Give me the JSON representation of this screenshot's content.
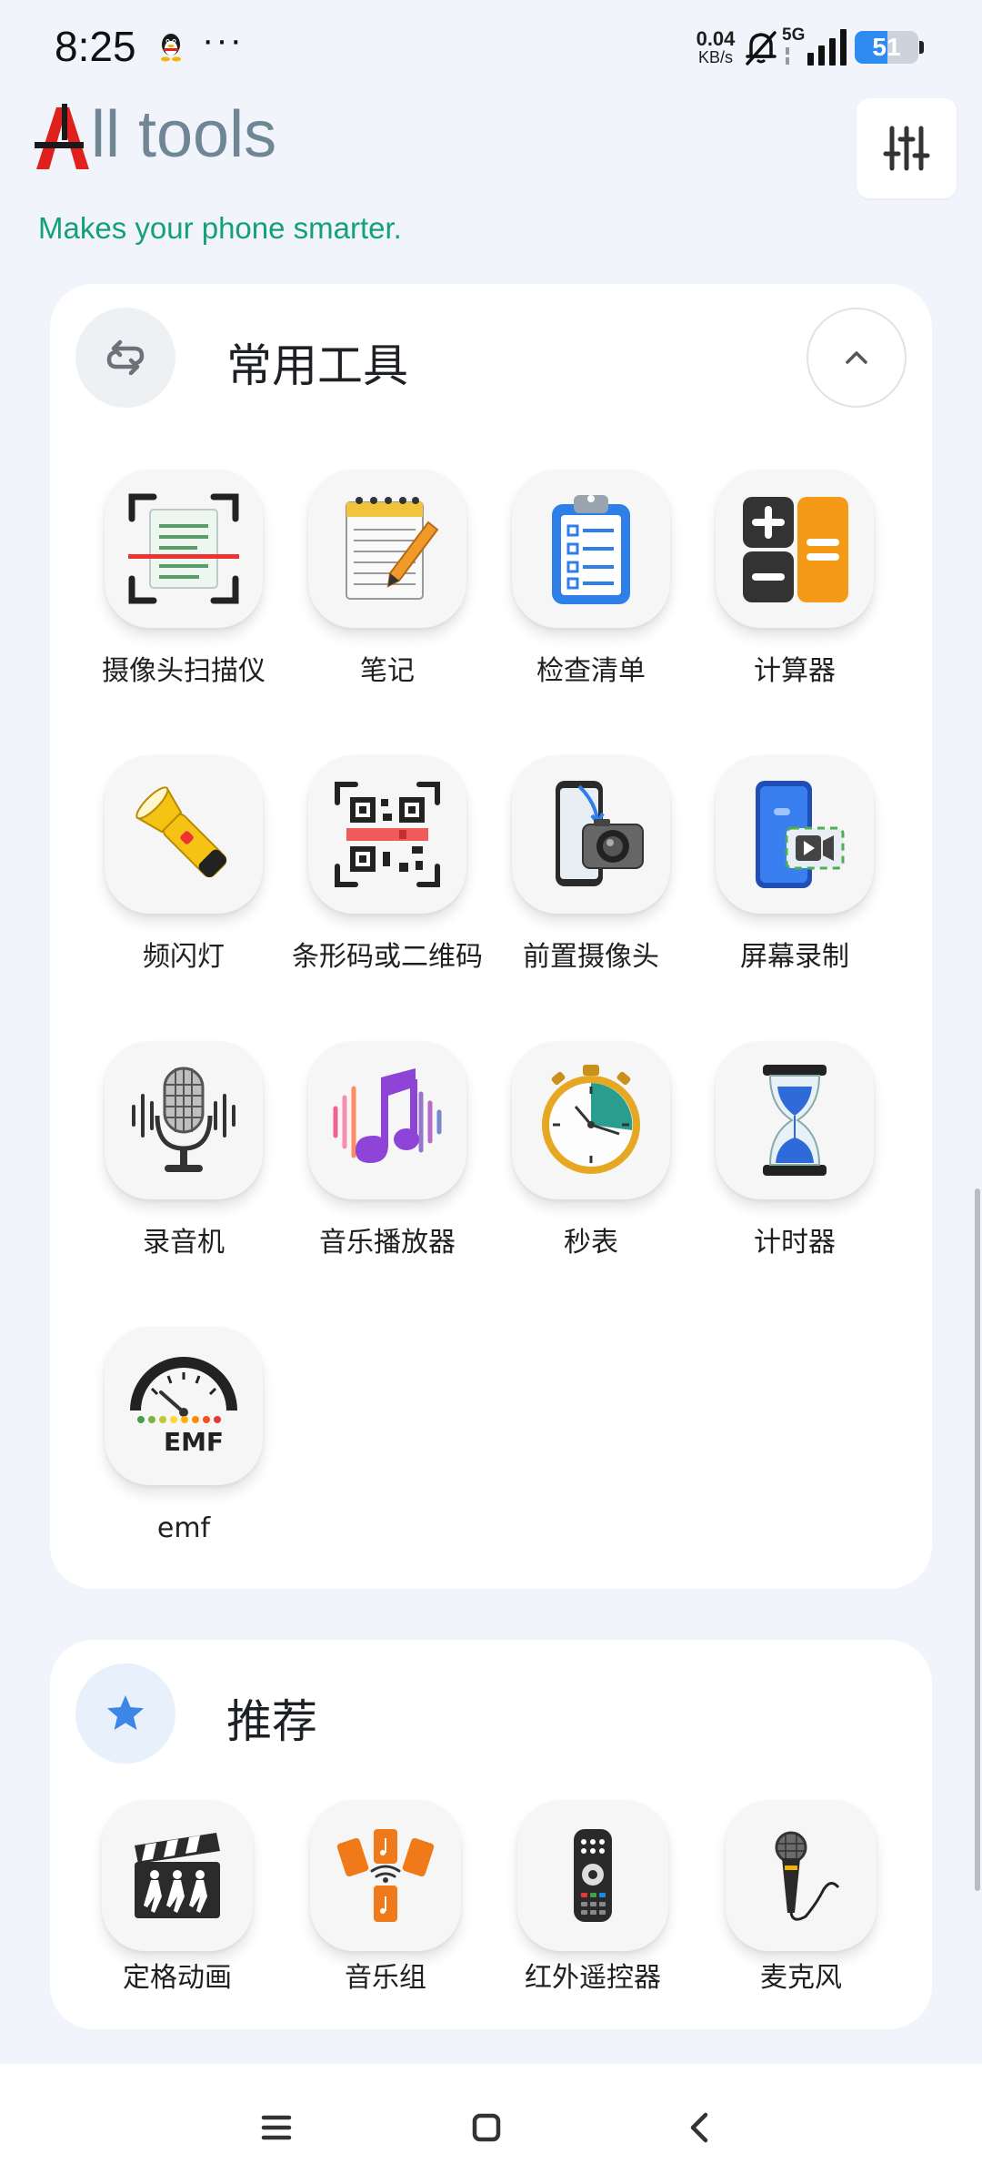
{
  "status_bar": {
    "time": "8:25",
    "dots": "···",
    "net_speed_value": "0.04",
    "net_speed_unit": "KB/s",
    "network": "5G",
    "battery": "51",
    "battery_level": 0.51
  },
  "header": {
    "title": "ll tools",
    "logo_letter": "A",
    "subtitle": "Makes your phone smarter.",
    "brand_color": "#e0201c"
  },
  "common_tools": {
    "title": "常用工具",
    "items": [
      {
        "label": "摄像头扫描仪",
        "icon": "document-scanner-icon"
      },
      {
        "label": "笔记",
        "icon": "notepad-icon"
      },
      {
        "label": "检查清单",
        "icon": "checklist-clipboard-icon"
      },
      {
        "label": "计算器",
        "icon": "calculator-icon"
      },
      {
        "label": "频闪灯",
        "icon": "flashlight-icon"
      },
      {
        "label": "条形码或二维码",
        "icon": "qr-code-icon"
      },
      {
        "label": "前置摄像头",
        "icon": "front-camera-icon"
      },
      {
        "label": "屏幕录制",
        "icon": "screen-recorder-icon"
      },
      {
        "label": "录音机",
        "icon": "microphone-recorder-icon"
      },
      {
        "label": "音乐播放器",
        "icon": "music-note-icon"
      },
      {
        "label": "秒表",
        "icon": "stopwatch-icon"
      },
      {
        "label": "计时器",
        "icon": "hourglass-icon"
      },
      {
        "label": "emf",
        "icon": "emf-meter-icon"
      }
    ]
  },
  "recommended": {
    "title": "推荐",
    "items": [
      {
        "label": "定格动画",
        "icon": "clapperboard-icon"
      },
      {
        "label": "音乐组",
        "icon": "music-group-icon"
      },
      {
        "label": "红外遥控器",
        "icon": "remote-control-icon"
      },
      {
        "label": "麦克风",
        "icon": "handheld-mic-icon"
      }
    ]
  },
  "emf_icon_text": "EMF",
  "colors": {
    "background": "#f1f4fa",
    "subtitle": "#14a07a",
    "title": "#6f8694",
    "accent_blue": "#3d86e6"
  }
}
